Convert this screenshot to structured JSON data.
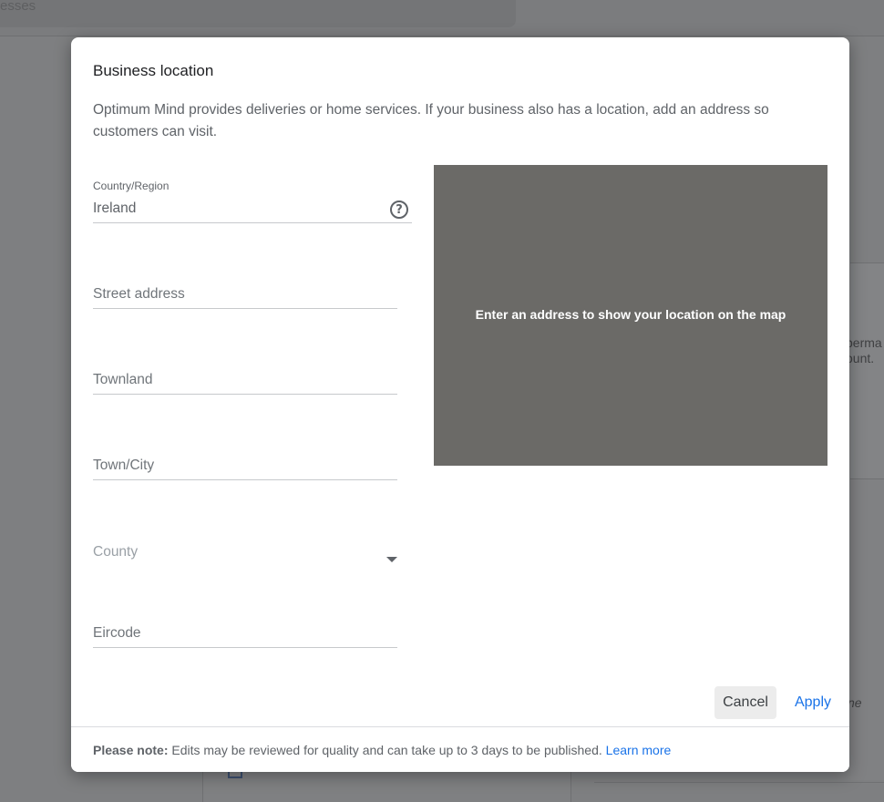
{
  "background": {
    "search_text": "esses",
    "right_text_line1": "perma",
    "right_text_line2": "ount.",
    "right_text_italic": "ne"
  },
  "dialog": {
    "title": "Business location",
    "description": "Optimum Mind provides deliveries or home services. If your business also has a location, add an address so customers can visit.",
    "fields": {
      "country": {
        "label": "Country/Region",
        "value": "Ireland"
      },
      "street": {
        "placeholder": "Street address"
      },
      "townland": {
        "placeholder": "Townland"
      },
      "town": {
        "placeholder": "Town/City"
      },
      "county": {
        "placeholder": "County"
      },
      "eircode": {
        "placeholder": "Eircode"
      }
    },
    "map": {
      "hint": "Enter an address to show your location on the map",
      "background_color": "#6b6a67"
    },
    "actions": {
      "cancel_label": "Cancel",
      "apply_label": "Apply"
    },
    "footer": {
      "note_bold": "Please note:",
      "note_text": " Edits may be reviewed for quality and can take up to 3 days to be published. ",
      "link_label": "Learn more"
    }
  },
  "colors": {
    "accent": "#1a73e8",
    "overlay": "#7e7f81"
  }
}
